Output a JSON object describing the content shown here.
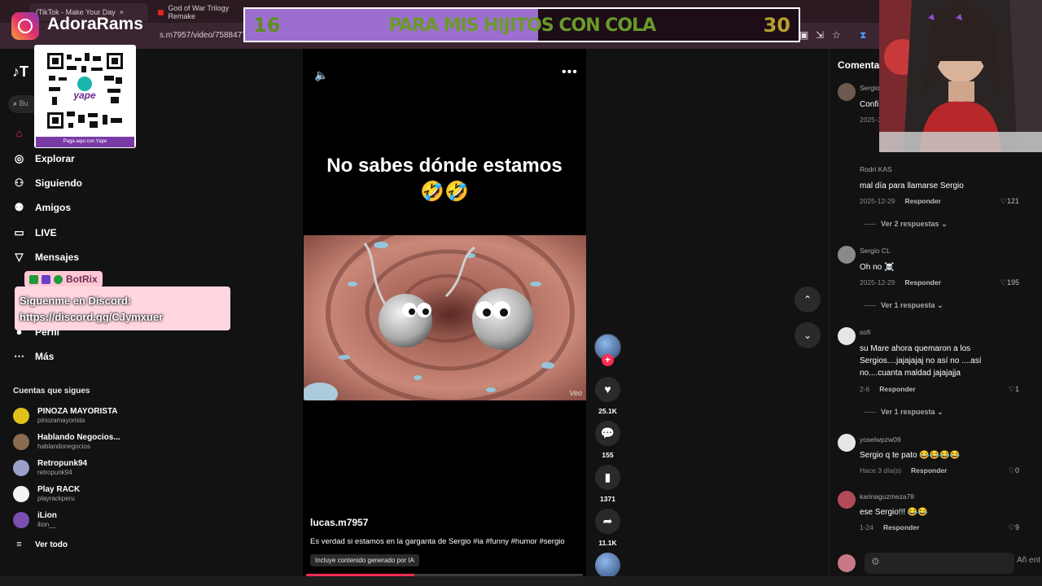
{
  "browser": {
    "tabs": [
      "(TikTok - Make Your Day",
      "God of War Trilogy Remake"
    ],
    "url": "s.m7957/video/7588477"
  },
  "overlay": {
    "instagram_name": "AdoraRams",
    "qr_caption": "Paga aqui con Yape",
    "goal": {
      "current": "16",
      "title": "PARA MIS HIJITOS CON COLA",
      "target": "30",
      "progress": 0.53
    },
    "botrix_name": "BotRix",
    "botrix_line1": "Siguenme en Discord:",
    "botrix_line2": "https://discord.gg/CJymxuer"
  },
  "sidebar": {
    "logo": "T",
    "search_placeholder": "Bu",
    "nav": [
      {
        "label": "Explorar",
        "icon": "compass-icon"
      },
      {
        "label": "Siguiendo",
        "icon": "people-icon"
      },
      {
        "label": "Amigos",
        "icon": "friends-icon"
      },
      {
        "label": "LIVE",
        "icon": "live-icon"
      },
      {
        "label": "Mensajes",
        "icon": "send-icon"
      },
      {
        "label": "Perfil",
        "icon": "profile-icon"
      },
      {
        "label": "Más",
        "icon": "more-icon"
      }
    ],
    "following_title": "Cuentas que sigues",
    "following": [
      {
        "name": "PINOZA MAYORISTA",
        "handle": "pinozamayorista",
        "color": "#e0c21a"
      },
      {
        "name": "Hablando Negocios...",
        "handle": "hablandonegocios",
        "color": "#8a6c50"
      },
      {
        "name": "Retropunk94",
        "handle": "retropunk94",
        "color": "#9aa0c8"
      },
      {
        "name": "Play RACK",
        "handle": "playrackperu",
        "color": "#f2f2f2"
      },
      {
        "name": "iLion",
        "handle": "ilion__",
        "color": "#7a4fb0"
      }
    ],
    "see_all": "Ver todo"
  },
  "video": {
    "title_line1": "No sabes dónde estamos",
    "title_line2": "🤣🤣",
    "watermark": "Veo",
    "author": "lucas.m7957",
    "description": "Es verdad si estamos en la garganta de Sergio #ia #funny #humor #sergio",
    "ai_label": "Incluye contenido generado por IA",
    "progress": 0.39,
    "likes": "25.1K",
    "comments": "155",
    "saves": "1371",
    "shares": "11.1K"
  },
  "comments": {
    "title": "Comenta",
    "items": [
      {
        "user": "Sergio",
        "text": "Confi",
        "date": "2025-1",
        "reply": "",
        "likes": "",
        "replies": ""
      },
      {
        "user": "Rodri KAS",
        "text": "mal día para llamarse Sergio",
        "date": "2025-12-29",
        "reply": "Responder",
        "likes": "121",
        "replies": "Ver 2 respuestas"
      },
      {
        "user": "Sergio CL",
        "text": "Oh no ☠️",
        "date": "2025-12-29",
        "reply": "Responder",
        "likes": "195",
        "replies": "Ver 1 respuesta"
      },
      {
        "user": "sofi",
        "text": "su Mare ahora quemaron a los Sergios....jajajajaj no así no ....así no....cuanta maldad jajajajja",
        "date": "2-6",
        "reply": "Responder",
        "likes": "1",
        "replies": "Ver 1 respuesta"
      },
      {
        "user": "yoselwpzw09",
        "text": "Sergio q te pato 😂😂😂😂",
        "date": "Hace 3 día(s)",
        "reply": "Responder",
        "likes": "0",
        "replies": ""
      },
      {
        "user": "karinaguzmeza78",
        "text": "ese Sergio!!! 😂😂",
        "date": "1-24",
        "reply": "Responder",
        "likes": "9",
        "replies": ""
      }
    ],
    "input_send": "Añ ent"
  }
}
